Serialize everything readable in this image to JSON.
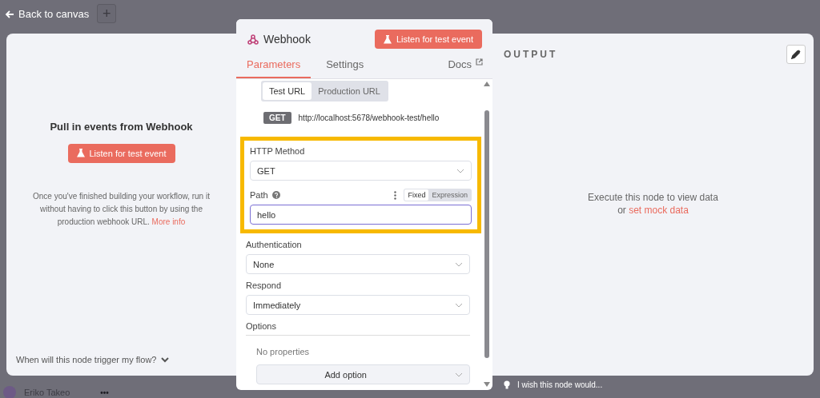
{
  "top_bar": {
    "back_label": "Back to canvas",
    "add_label": "+"
  },
  "input_panel": {
    "title": "Pull in events from Webhook",
    "listen_button": "Listen for test event",
    "description": "Once you've finished building your workflow, run it without having to click this button by using the production webhook URL.",
    "more_link": "More info",
    "faq": "When will this node trigger my flow?"
  },
  "node_panel": {
    "title": "Webhook",
    "listen_button": "Listen for test event",
    "tabs": [
      {
        "label": "Parameters",
        "selected": true
      },
      {
        "label": "Settings",
        "selected": false
      }
    ],
    "docs_link": "Docs",
    "url_tabs": [
      {
        "label": "Test URL",
        "selected": true
      },
      {
        "label": "Production URL",
        "selected": false
      }
    ],
    "method_badge": "GET",
    "url": "http://localhost:5678/webhook-test/hello",
    "http_method": {
      "label": "HTTP Method",
      "value": "GET"
    },
    "path": {
      "label": "Path",
      "modes": [
        {
          "label": "Fixed",
          "selected": true
        },
        {
          "label": "Expression",
          "selected": false
        }
      ],
      "value": "hello"
    },
    "authentication": {
      "label": "Authentication",
      "value": "None"
    },
    "respond": {
      "label": "Respond",
      "value": "Immediately"
    },
    "options": {
      "label": "Options",
      "empty": "No properties",
      "add_button": "Add option"
    }
  },
  "output_panel": {
    "title": "OUTPUT",
    "message": "Execute this node to view data",
    "or": "or",
    "mock_link": "set mock data"
  },
  "footer": {
    "user_name": "Eriko Takeo",
    "more": "•••",
    "feedback": "I wish this node would..."
  }
}
